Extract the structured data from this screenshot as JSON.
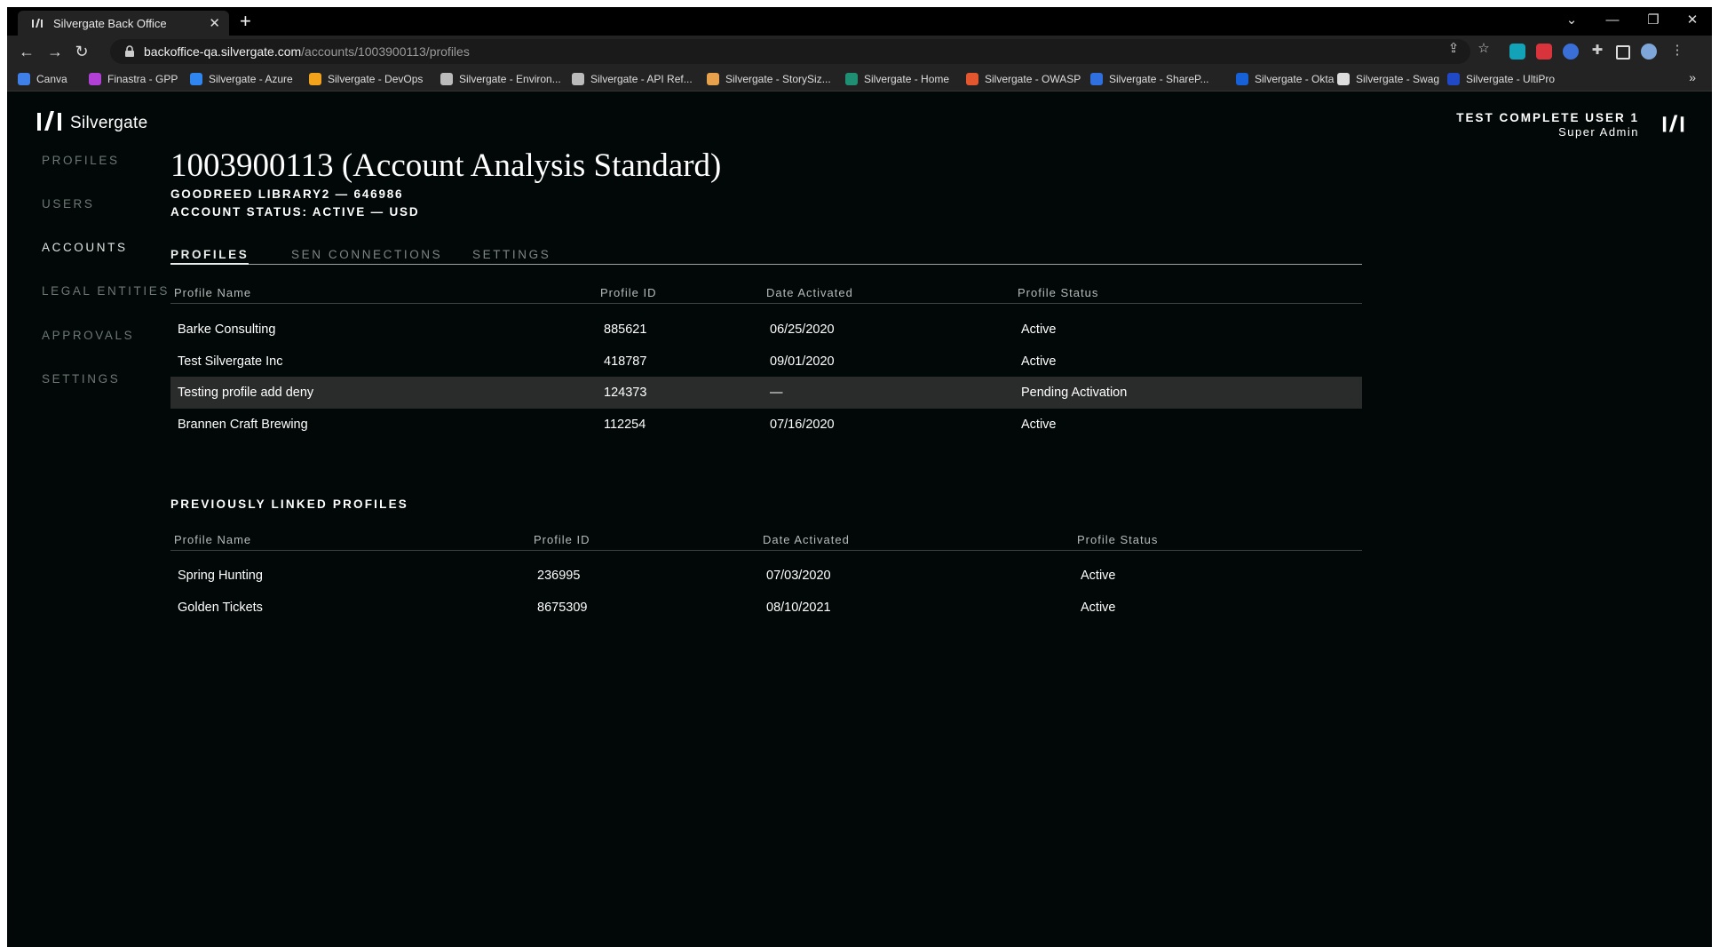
{
  "browser": {
    "tab_title": "Silvergate Back Office",
    "url_host": "backoffice-qa.silvergate.com",
    "url_path": "/accounts/1003900113/profiles",
    "bookmarks": [
      {
        "label": "Canva",
        "color": "#3f7fe8"
      },
      {
        "label": "Finastra - GPP",
        "color": "#b23fd6"
      },
      {
        "label": "Silvergate - Azure",
        "color": "#2f86f0"
      },
      {
        "label": "Silvergate - DevOps",
        "color": "#f2a31b"
      },
      {
        "label": "Silvergate - Environ...",
        "color": "#bbbbbb"
      },
      {
        "label": "Silvergate - API Ref...",
        "color": "#bbbbbb"
      },
      {
        "label": "Silvergate - StorySiz...",
        "color": "#e7a04b"
      },
      {
        "label": "Silvergate - Home",
        "color": "#1f8f74"
      },
      {
        "label": "Silvergate - OWASP",
        "color": "#e4572e"
      },
      {
        "label": "Silvergate - ShareP...",
        "color": "#2f6fe0"
      },
      {
        "label": "Silvergate - Okta",
        "color": "#1660d8"
      },
      {
        "label": "Silvergate - Swag",
        "color": "#dddddd"
      },
      {
        "label": "Silvergate - UltiPro",
        "color": "#1f49c7"
      }
    ]
  },
  "app": {
    "brand": "Silvergate",
    "user_name": "TEST COMPLETE USER 1",
    "user_role": "Super Admin",
    "nav": [
      {
        "label": "PROFILES",
        "active": false
      },
      {
        "label": "USERS",
        "active": false
      },
      {
        "label": "ACCOUNTS",
        "active": true
      },
      {
        "label": "LEGAL ENTITIES",
        "active": false
      },
      {
        "label": "APPROVALS",
        "active": false
      },
      {
        "label": "SETTINGS",
        "active": false
      }
    ],
    "account_title": "1003900113 (Account Analysis Standard)",
    "entity_line": "GOODREED LIBRARY2 — 646986",
    "status_line": "ACCOUNT STATUS: ACTIVE — USD",
    "tabs": [
      "PROFILES",
      "SEN CONNECTIONS",
      "SETTINGS"
    ],
    "profiles_table": {
      "columns": [
        "Profile Name",
        "Profile ID",
        "Date Activated",
        "Profile Status"
      ],
      "rows": [
        [
          "Barke Consulting",
          "885621",
          "06/25/2020",
          "Active"
        ],
        [
          "Test Silvergate Inc",
          "418787",
          "09/01/2020",
          "Active"
        ],
        [
          "Testing profile add deny",
          "124373",
          "—",
          "Pending Activation"
        ],
        [
          "Brannen Craft Brewing",
          "112254",
          "07/16/2020",
          "Active"
        ]
      ]
    },
    "previous_heading": "PREVIOUSLY LINKED PROFILES",
    "previous_table": {
      "columns": [
        "Profile Name",
        "Profile ID",
        "Date Activated",
        "Profile Status"
      ],
      "rows": [
        [
          "Spring Hunting",
          "236995",
          "07/03/2020",
          "Active"
        ],
        [
          "Golden Tickets",
          "8675309",
          "08/10/2021",
          "Active"
        ]
      ]
    }
  }
}
